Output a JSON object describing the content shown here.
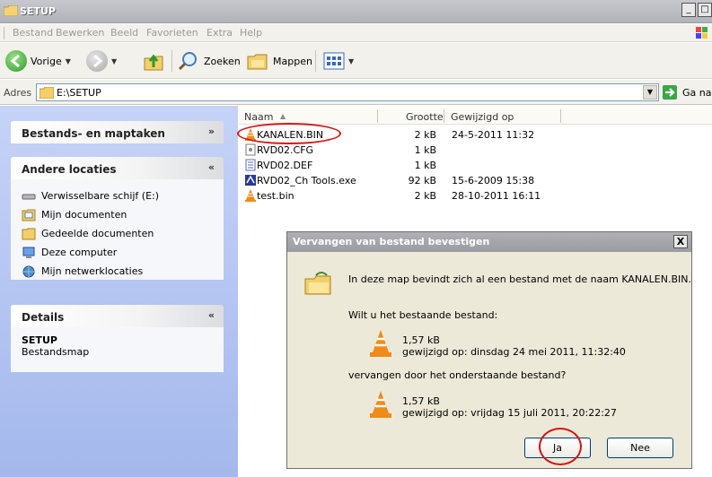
{
  "window": {
    "title": "SETUP",
    "min_label": "_",
    "max_label": "□"
  },
  "menu": [
    "Bestand",
    "Bewerken",
    "Beeld",
    "Favorieten",
    "Extra",
    "Help"
  ],
  "toolbar": {
    "back_label": "Vorige",
    "search_label": "Zoeken",
    "folders_label": "Mappen"
  },
  "address": {
    "label": "Adres",
    "value": "E:\\SETUP",
    "go_label": "Ga na"
  },
  "tasks": {
    "panel1": {
      "title": "Bestands- en maptaken",
      "chevron": "»"
    },
    "panel2": {
      "title": "Andere locaties",
      "chevron": "«",
      "items": [
        "Verwisselbare schijf (E:)",
        "Mijn documenten",
        "Gedeelde documenten",
        "Deze computer",
        "Mijn netwerklocaties"
      ]
    },
    "panel3": {
      "title": "Details",
      "chevron": "«",
      "name": "SETUP",
      "type": "Bestandsmap"
    }
  },
  "columns": {
    "name": "Naam",
    "size": "Grootte",
    "modified": "Gewijzigd op"
  },
  "files": [
    {
      "name": "KANALEN.BIN",
      "size": "2 kB",
      "date": "24-5-2011 11:32",
      "icon": "vlc-cone-icon"
    },
    {
      "name": "RVD02.CFG",
      "size": "1 kB",
      "date": "",
      "icon": "config-file-icon"
    },
    {
      "name": "RVD02.DEF",
      "size": "1 kB",
      "date": "",
      "icon": "text-file-icon"
    },
    {
      "name": "RVD02_Ch Tools.exe",
      "size": "92 kB",
      "date": "15-6-2009 15:38",
      "icon": "exe-icon"
    },
    {
      "name": "test.bin",
      "size": "2 kB",
      "date": "28-10-2011 16:11",
      "icon": "vlc-cone-icon"
    }
  ],
  "dialog": {
    "title": "Vervangen van bestand bevestigen",
    "close_label": "X",
    "message": "In deze map bevindt zich al een bestand met de naam KANALEN.BIN.",
    "question": "Wilt u het bestaande bestand:",
    "existing_size": "1,57 kB",
    "existing_date": "gewijzigd op: dinsdag 24 mei 2011, 11:32:40",
    "replace_with": "vervangen door het onderstaande bestand?",
    "new_size": "1,57 kB",
    "new_date": "gewijzigd op: vrijdag 15 juli 2011, 20:22:27",
    "yes_label": "Ja",
    "no_label": "Nee"
  }
}
